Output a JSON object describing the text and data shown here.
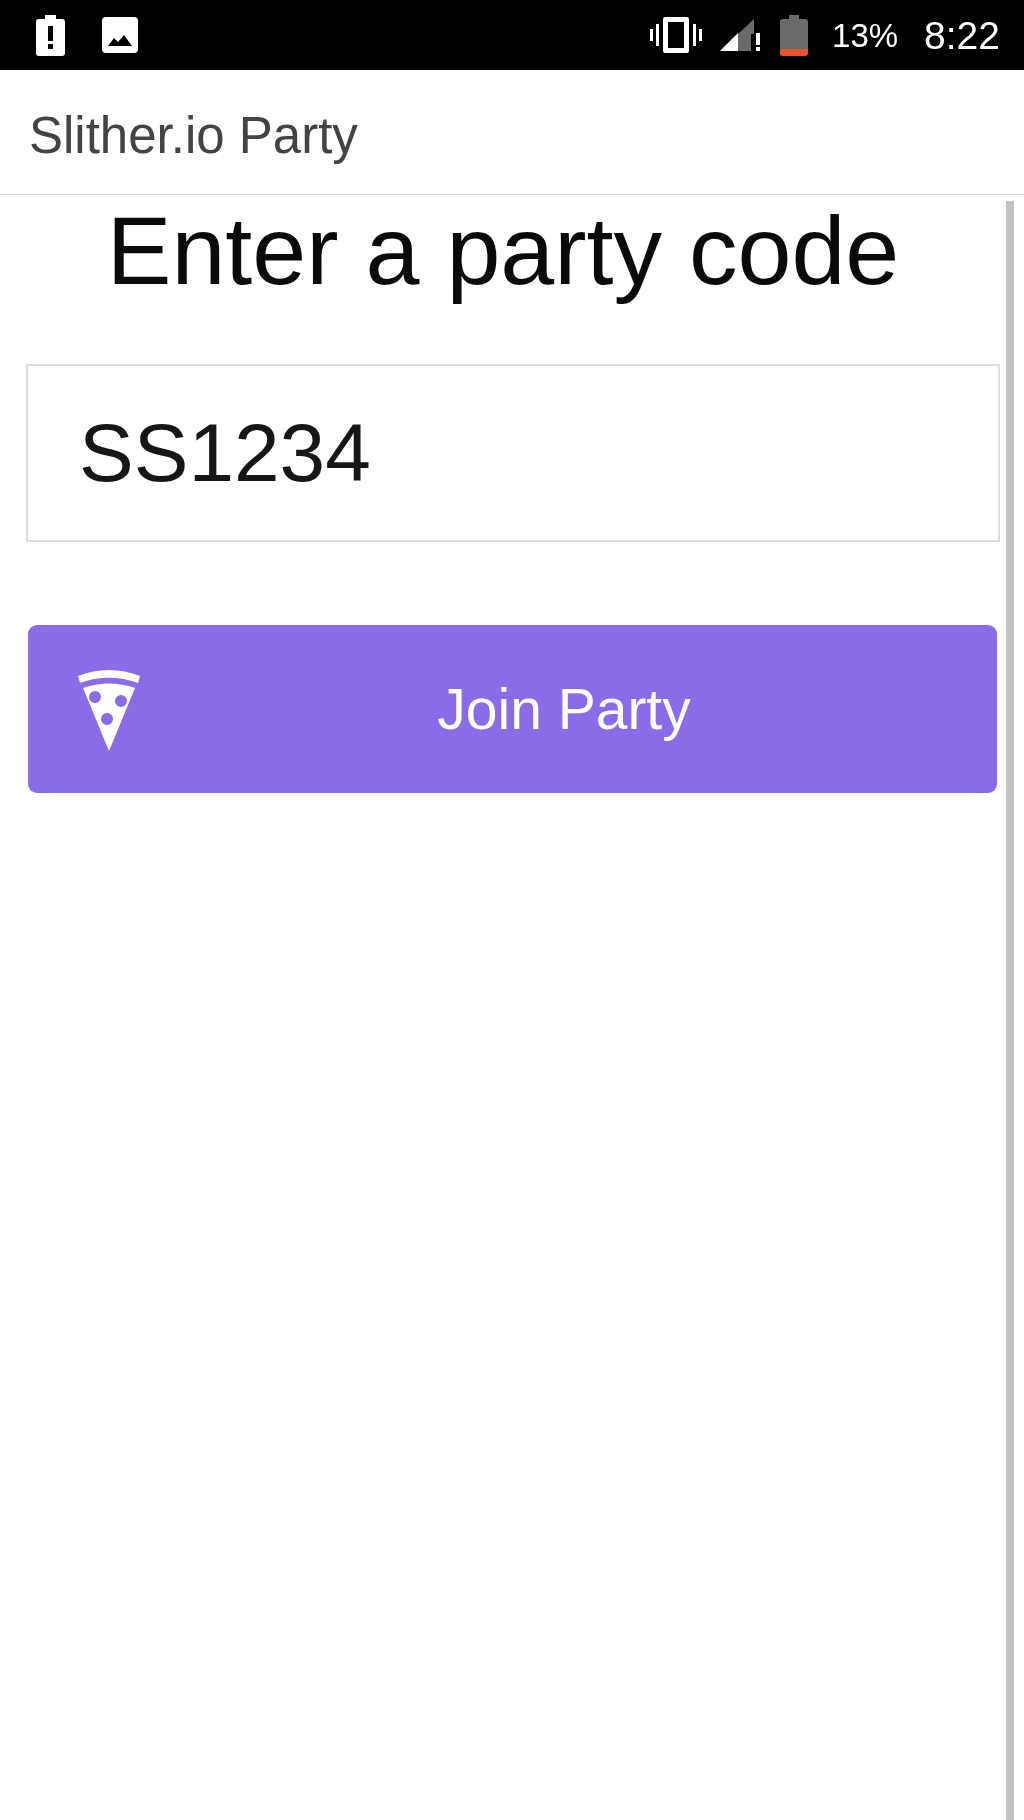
{
  "status_bar": {
    "battery_percent": "13%",
    "time": "8:22"
  },
  "app_bar": {
    "title": "Slither.io Party"
  },
  "heading": "Enter a party code",
  "code_field": {
    "value": "SS1234"
  },
  "join_button": {
    "label": "Join Party"
  }
}
